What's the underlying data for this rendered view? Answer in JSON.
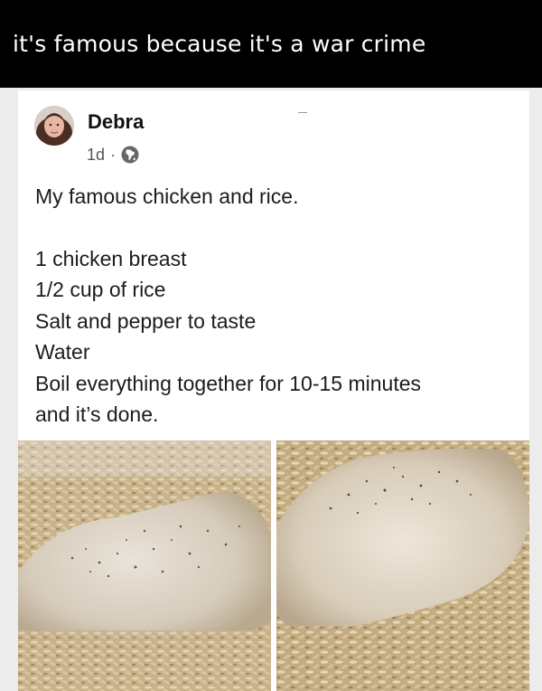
{
  "meme": {
    "caption": "it's famous because it's a war crime"
  },
  "post": {
    "author": "Debra",
    "timestamp": "1d",
    "separator": "·",
    "privacy_icon": "globe-icon",
    "text_title": "My famous chicken and rice.",
    "lines": [
      "1 chicken breast",
      "1/2 cup of rice",
      "Salt and pepper to taste",
      "Water",
      "Boil everything together for 10-15 minutes",
      "and it’s done."
    ],
    "photos": [
      "chicken-rice-photo-left",
      "chicken-rice-photo-right"
    ]
  }
}
